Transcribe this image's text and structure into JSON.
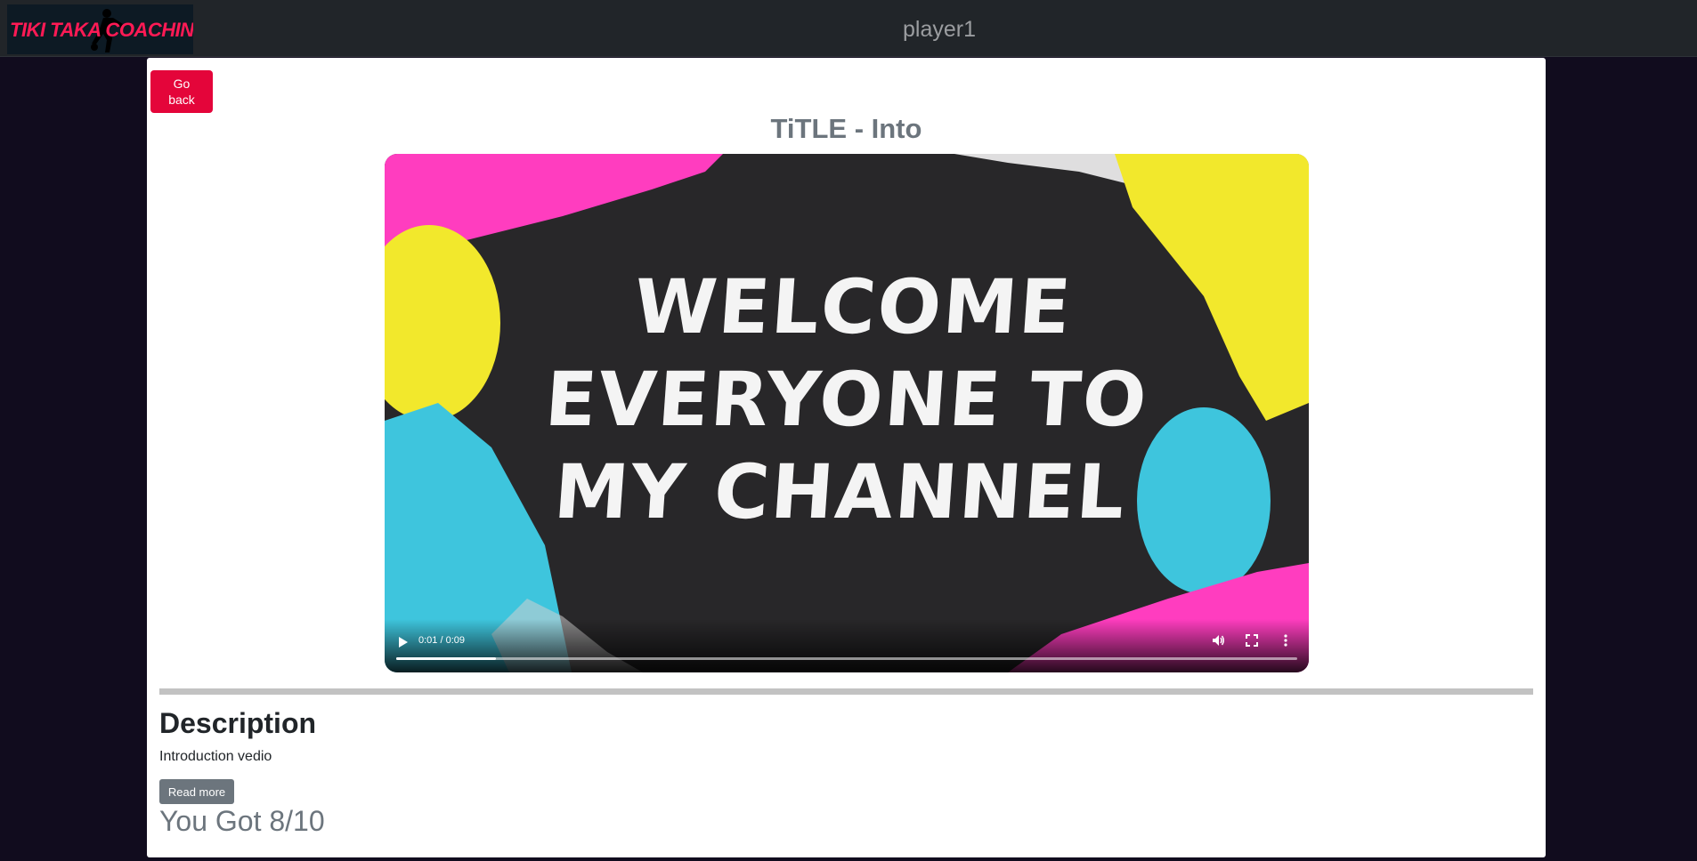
{
  "header": {
    "logo_text": "TIKI TAKA COACHING",
    "title": "player1"
  },
  "page": {
    "back_label": "Go back",
    "video_title": "TiTLE - Into"
  },
  "video": {
    "poster_lines": [
      "WELCOME",
      "EVERYONE TO",
      "MY CHANNEL"
    ],
    "time": "0:01 / 0:09",
    "progress": 0.111,
    "icons": [
      "play-icon",
      "volume-icon",
      "fullscreen-icon",
      "more-options-icon"
    ]
  },
  "description": {
    "heading": "Description",
    "text": "Introduction vedio",
    "read_more_label": "Read more"
  },
  "score_text": "You Got 8/10",
  "colors": {
    "accent": "#e4053a",
    "navbar": "#212529",
    "background": "#110c1e",
    "secondary": "#6c757d"
  }
}
